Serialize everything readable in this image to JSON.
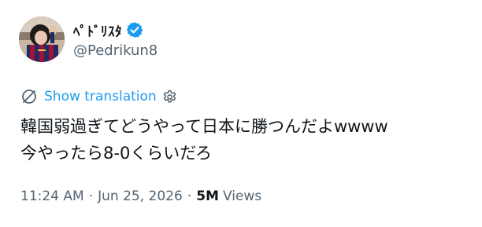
{
  "author": {
    "display_name": "ﾍﾟﾄﾞﾘｽﾀ",
    "handle": "@Pedrikun8",
    "verified": true,
    "avatar": "avatar-photo"
  },
  "translation": {
    "label": "Show translation",
    "icon": "translate-icon",
    "settings_icon": "gear-icon"
  },
  "tweet": {
    "lines": [
      "韓国弱過ぎてどうやって日本に勝つんだよwwww",
      "今やったら8-0くらいだろ"
    ]
  },
  "meta": {
    "time": "11:24 AM",
    "separator": "·",
    "date": "Jun 25, 2026",
    "views_count": "5M",
    "views_label": "Views"
  },
  "colors": {
    "text": "#0f1419",
    "secondary": "#536471",
    "accent": "#1d9bf0"
  }
}
